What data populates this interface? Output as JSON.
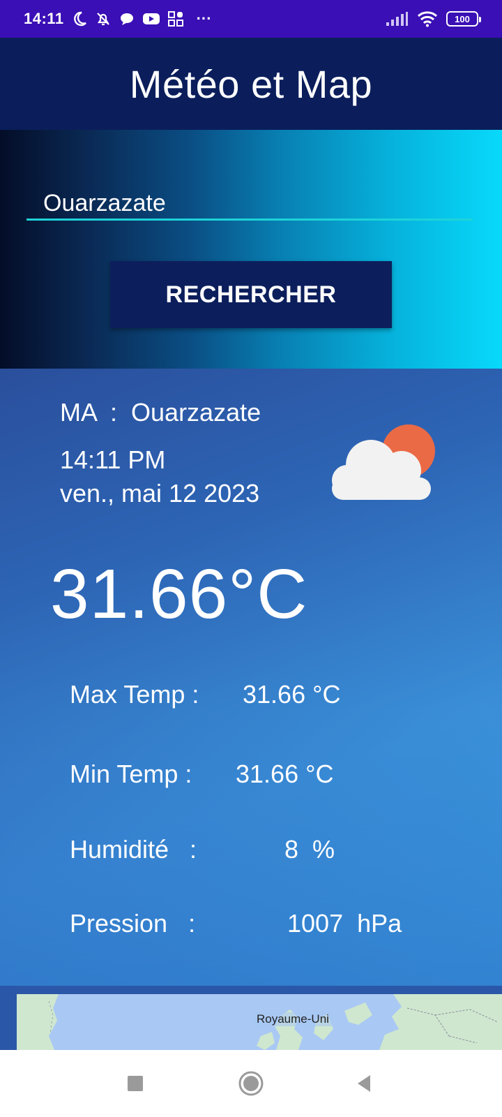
{
  "status_bar": {
    "time": "14:11",
    "more": "···",
    "battery": "100"
  },
  "app": {
    "title": "Météo et Map"
  },
  "search": {
    "value": "Ouarzazate",
    "button_label": "RECHERCHER"
  },
  "weather": {
    "location": "MA  :  Ouarzazate",
    "time": "14:11 PM",
    "date": "ven., mai 12 2023",
    "temperature": "31.66°C",
    "icon": "partly-cloudy-icon",
    "stats": [
      {
        "label": "Max Temp :",
        "value": "31.66 °C"
      },
      {
        "label": "Min Temp :",
        "value": "31.66 °C"
      },
      {
        "label": "Humidité   :",
        "value": "8  %"
      },
      {
        "label": "Pression   :",
        "value": "1007  hPa"
      }
    ]
  },
  "map": {
    "label": "Royaume-Uni"
  },
  "nav": {
    "icons": [
      "recents-icon",
      "home-icon",
      "back-icon"
    ]
  },
  "colors": {
    "status_bar": "#3a0fb5",
    "app_bar": "#0b1e5b",
    "input_underline": "#1ed3d8",
    "button": "#0c1f5c",
    "sun": "#ea6a45",
    "cloud": "#f2f2f2"
  }
}
